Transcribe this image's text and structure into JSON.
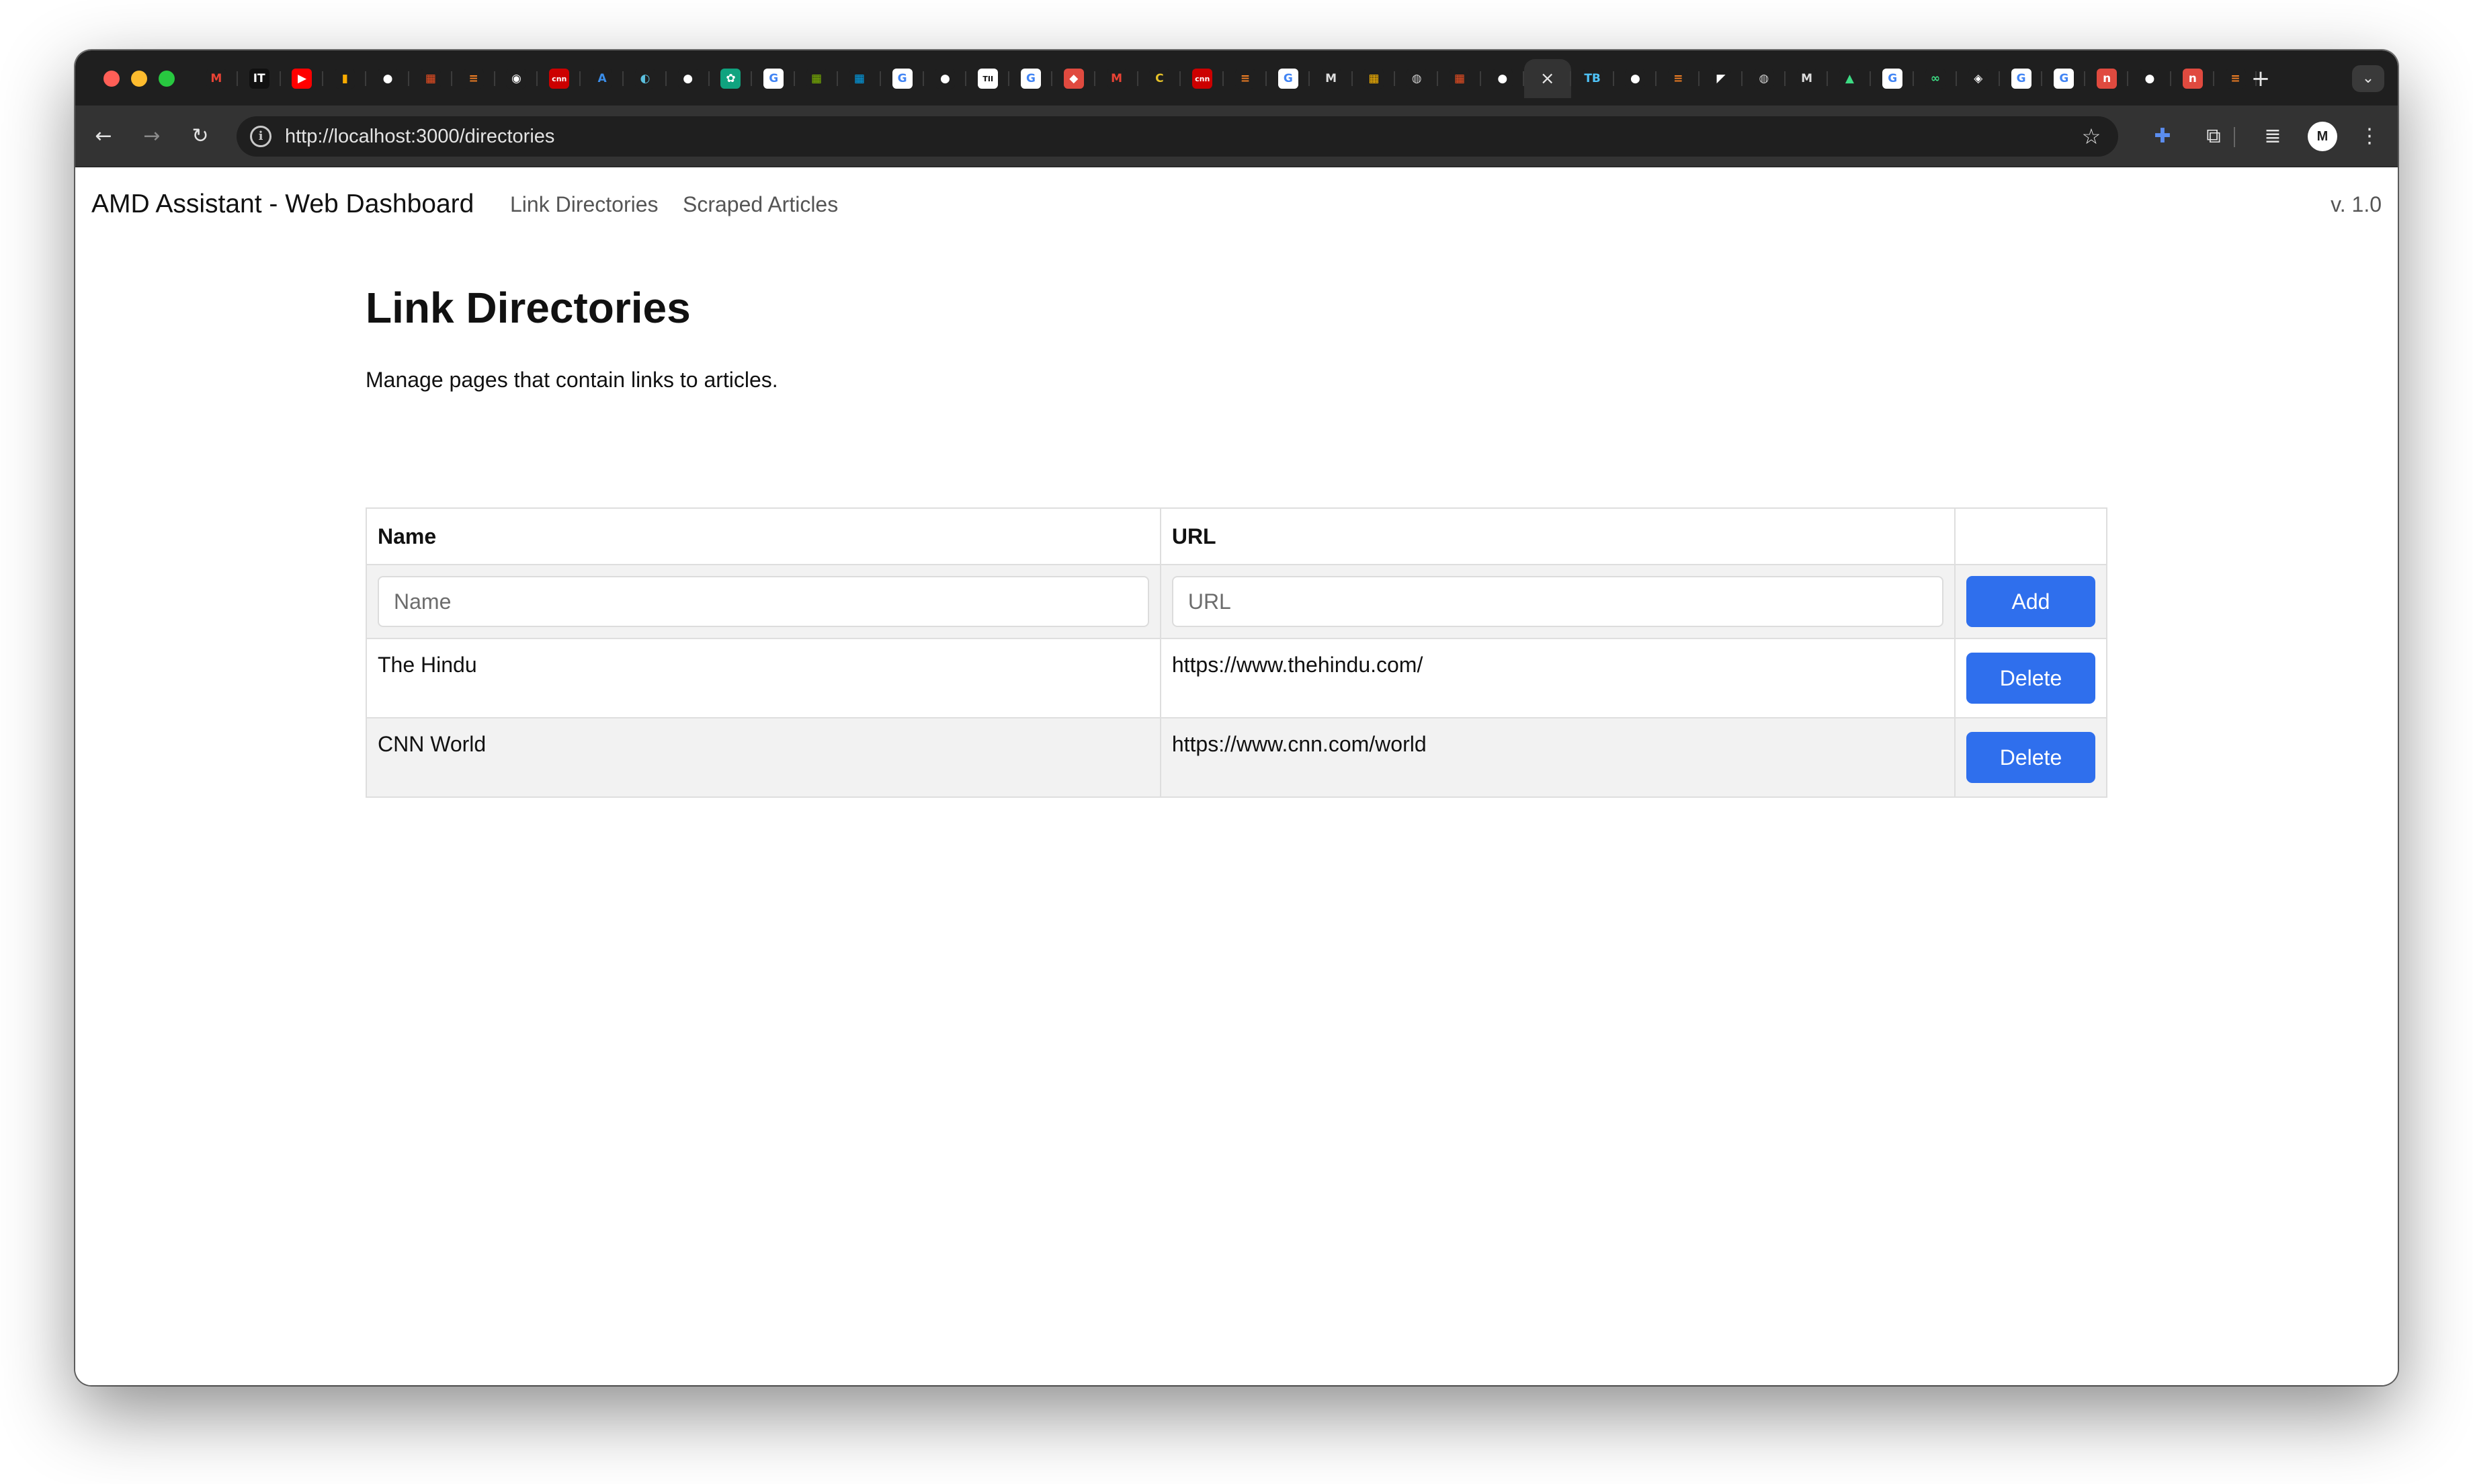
{
  "browser": {
    "tabs": [
      {
        "icon": "gmail-icon",
        "glyph": "M",
        "bg": "#1f1f1f",
        "fg": "#ea4335"
      },
      {
        "icon": "it-icon",
        "glyph": "IT",
        "bg": "#111111",
        "fg": "#ffffff"
      },
      {
        "icon": "youtube-icon",
        "glyph": "▶",
        "bg": "#ff0000",
        "fg": "#ffffff"
      },
      {
        "icon": "google-analytics-icon",
        "glyph": "▮",
        "bg": "#1f1f1f",
        "fg": "#f9ab00"
      },
      {
        "icon": "github-icon",
        "glyph": "●",
        "bg": "#1f1f1f",
        "fg": "#ffffff"
      },
      {
        "icon": "microsoft-icon",
        "glyph": "▦",
        "bg": "#1f1f1f",
        "fg": "#f25022"
      },
      {
        "icon": "stackoverflow-icon",
        "glyph": "≡",
        "bg": "#1f1f1f",
        "fg": "#f48024"
      },
      {
        "icon": "site-icon",
        "glyph": "◉",
        "bg": "#1f1f1f",
        "fg": "#ffffff"
      },
      {
        "icon": "cnn-icon",
        "glyph": "cnn",
        "bg": "#cc0000",
        "fg": "#ffffff"
      },
      {
        "icon": "azure-icon",
        "glyph": "A",
        "bg": "#1f1f1f",
        "fg": "#3b8eea"
      },
      {
        "icon": "edge-icon",
        "glyph": "◐",
        "bg": "#1f1f1f",
        "fg": "#5bc0de"
      },
      {
        "icon": "github-icon",
        "glyph": "●",
        "bg": "#1f1f1f",
        "fg": "#ffffff"
      },
      {
        "icon": "chatgpt-icon",
        "glyph": "✿",
        "bg": "#10a37f",
        "fg": "#ffffff"
      },
      {
        "icon": "google-icon",
        "glyph": "G",
        "bg": "#ffffff",
        "fg": "#4285f4"
      },
      {
        "icon": "microsoft-icon",
        "glyph": "▦",
        "bg": "#1f1f1f",
        "fg": "#7fba00"
      },
      {
        "icon": "microsoft-icon",
        "glyph": "▦",
        "bg": "#1f1f1f",
        "fg": "#00a4ef"
      },
      {
        "icon": "google-icon",
        "glyph": "G",
        "bg": "#ffffff",
        "fg": "#4285f4"
      },
      {
        "icon": "github-icon",
        "glyph": "●",
        "bg": "#1f1f1f",
        "fg": "#ffffff"
      },
      {
        "icon": "tii-icon",
        "glyph": "TII",
        "bg": "#ffffff",
        "fg": "#111111"
      },
      {
        "icon": "google-icon",
        "glyph": "G",
        "bg": "#ffffff",
        "fg": "#4285f4"
      },
      {
        "icon": "bookmark-red-icon",
        "glyph": "◆",
        "bg": "#e04a3f",
        "fg": "#ffffff"
      },
      {
        "icon": "gmail-icon",
        "glyph": "M",
        "bg": "#1f1f1f",
        "fg": "#ea4335"
      },
      {
        "icon": "c-icon",
        "glyph": "C",
        "bg": "#1f1f1f",
        "fg": "#e6c229"
      },
      {
        "icon": "cnn-icon",
        "glyph": "cnn",
        "bg": "#cc0000",
        "fg": "#ffffff"
      },
      {
        "icon": "stackoverflow-icon",
        "glyph": "≡",
        "bg": "#1f1f1f",
        "fg": "#f48024"
      },
      {
        "icon": "google-icon",
        "glyph": "G",
        "bg": "#ffffff",
        "fg": "#4285f4"
      },
      {
        "icon": "medium-icon",
        "glyph": "M",
        "bg": "#1f1f1f",
        "fg": "#dddddd"
      },
      {
        "icon": "microsoft-icon",
        "glyph": "▦",
        "bg": "#1f1f1f",
        "fg": "#ffb900"
      },
      {
        "icon": "globe-icon",
        "glyph": "◍",
        "bg": "#1f1f1f",
        "fg": "#cccccc"
      },
      {
        "icon": "microsoft-icon",
        "glyph": "▦",
        "bg": "#1f1f1f",
        "fg": "#f25022"
      },
      {
        "icon": "github-icon",
        "glyph": "●",
        "bg": "#1f1f1f",
        "fg": "#ffffff"
      },
      {
        "icon": "close-tab-icon",
        "glyph": "×",
        "bg": "transparent",
        "fg": "#e8e8e8",
        "active": true
      },
      {
        "icon": "typescript-icon",
        "glyph": "TB",
        "bg": "#1f1f1f",
        "fg": "#4fc3f7"
      },
      {
        "icon": "github-icon",
        "glyph": "●",
        "bg": "#1f1f1f",
        "fg": "#ffffff"
      },
      {
        "icon": "stackoverflow-icon",
        "glyph": "≡",
        "bg": "#1f1f1f",
        "fg": "#f48024"
      },
      {
        "icon": "site-icon",
        "glyph": "◤",
        "bg": "#1f1f1f",
        "fg": "#ffffff"
      },
      {
        "icon": "globe-icon",
        "glyph": "◍",
        "bg": "#1f1f1f",
        "fg": "#cccccc"
      },
      {
        "icon": "medium-icon",
        "glyph": "M",
        "bg": "#1f1f1f",
        "fg": "#dddddd"
      },
      {
        "icon": "android-icon",
        "glyph": "▲",
        "bg": "#1f1f1f",
        "fg": "#3ddc84"
      },
      {
        "icon": "google-icon",
        "glyph": "G",
        "bg": "#ffffff",
        "fg": "#4285f4"
      },
      {
        "icon": "infinity-icon",
        "glyph": "∞",
        "bg": "#1f1f1f",
        "fg": "#3ddc84"
      },
      {
        "icon": "layers-icon",
        "glyph": "◈",
        "bg": "#1f1f1f",
        "fg": "#ffffff"
      },
      {
        "icon": "google-icon",
        "glyph": "G",
        "bg": "#ffffff",
        "fg": "#4285f4"
      },
      {
        "icon": "google-icon",
        "glyph": "G",
        "bg": "#ffffff",
        "fg": "#4285f4"
      },
      {
        "icon": "bookmark-red-icon",
        "glyph": "n",
        "bg": "#e04a3f",
        "fg": "#ffffff"
      },
      {
        "icon": "github-icon",
        "glyph": "●",
        "bg": "#1f1f1f",
        "fg": "#ffffff"
      },
      {
        "icon": "bookmark-red-icon",
        "glyph": "n",
        "bg": "#e04a3f",
        "fg": "#ffffff"
      },
      {
        "icon": "stackoverflow-icon",
        "glyph": "≡",
        "bg": "#1f1f1f",
        "fg": "#f48024"
      }
    ],
    "new_tab_glyph": "+",
    "tab_menu_glyph": "⌄",
    "back_glyph": "←",
    "forward_glyph": "→",
    "reload_glyph": "↻",
    "info_glyph": "i",
    "url": "http://localhost:3000/directories",
    "star_glyph": "☆",
    "extensions_glyph": "⧉",
    "puzzle_glyph": "✚",
    "media_glyph": "≣",
    "profile_initials": "M",
    "menu_glyph": "⋮",
    "accent": "#2f6fed"
  },
  "nav": {
    "brand": "AMD Assistant - Web Dashboard",
    "links": [
      "Link Directories",
      "Scraped Articles"
    ],
    "version": "v. 1.0"
  },
  "main": {
    "title": "Link Directories",
    "description": "Manage pages that contain links to articles.",
    "table": {
      "headers": [
        "Name",
        "URL",
        ""
      ],
      "new_row": {
        "name_placeholder": "Name",
        "url_placeholder": "URL",
        "add_label": "Add"
      },
      "rows": [
        {
          "name": "The Hindu",
          "url": "https://www.thehindu.com/",
          "action": "Delete"
        },
        {
          "name": "CNN World",
          "url": "https://www.cnn.com/world",
          "action": "Delete"
        }
      ]
    }
  }
}
